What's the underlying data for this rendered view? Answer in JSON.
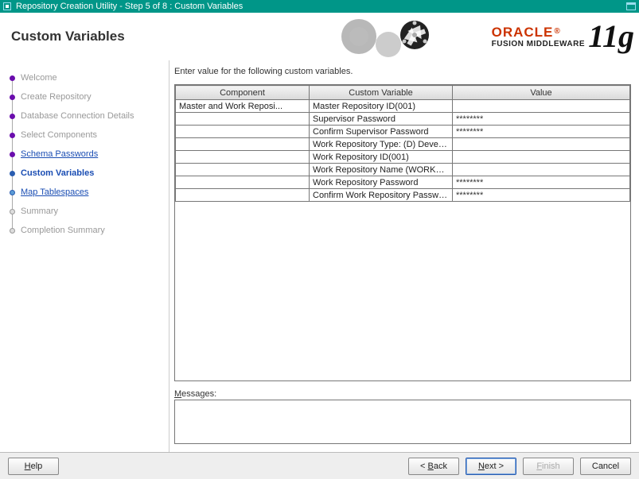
{
  "titlebar": {
    "title": "Repository Creation Utility - Step 5 of 8 : Custom Variables"
  },
  "header": {
    "page_title": "Custom Variables",
    "brand_line1": "ORACLE",
    "brand_line2": "FUSION MIDDLEWARE",
    "brand_version": "11g"
  },
  "sidebar": {
    "steps": [
      {
        "label": "Welcome",
        "state": "done"
      },
      {
        "label": "Create Repository",
        "state": "done"
      },
      {
        "label": "Database Connection Details",
        "state": "done"
      },
      {
        "label": "Select Components",
        "state": "done"
      },
      {
        "label": "Schema Passwords",
        "state": "link"
      },
      {
        "label": "Custom Variables",
        "state": "current"
      },
      {
        "label": "Map Tablespaces",
        "state": "link"
      },
      {
        "label": "Summary",
        "state": "future"
      },
      {
        "label": "Completion Summary",
        "state": "future"
      }
    ]
  },
  "main": {
    "instruction": "Enter value for the following custom variables.",
    "columns": [
      "Component",
      "Custom Variable",
      "Value"
    ],
    "rows": [
      {
        "component": "Master and Work Reposi...",
        "variable": "Master Repository ID(001)",
        "value": ""
      },
      {
        "component": "",
        "variable": "Supervisor Password",
        "value": "********"
      },
      {
        "component": "",
        "variable": "Confirm Supervisor Password",
        "value": "********"
      },
      {
        "component": "",
        "variable": "Work Repository Type: (D) Develo...",
        "value": ""
      },
      {
        "component": "",
        "variable": "Work Repository ID(001)",
        "value": ""
      },
      {
        "component": "",
        "variable": "Work Repository Name (WORKREP)",
        "value": ""
      },
      {
        "component": "",
        "variable": "Work Repository Password",
        "value": "********"
      },
      {
        "component": "",
        "variable": "Confirm Work Repository Password",
        "value": "********"
      }
    ],
    "messages_label": "Messages:"
  },
  "footer": {
    "help": "Help",
    "back": "Back",
    "next": "Next",
    "finish": "Finish",
    "cancel": "Cancel"
  }
}
